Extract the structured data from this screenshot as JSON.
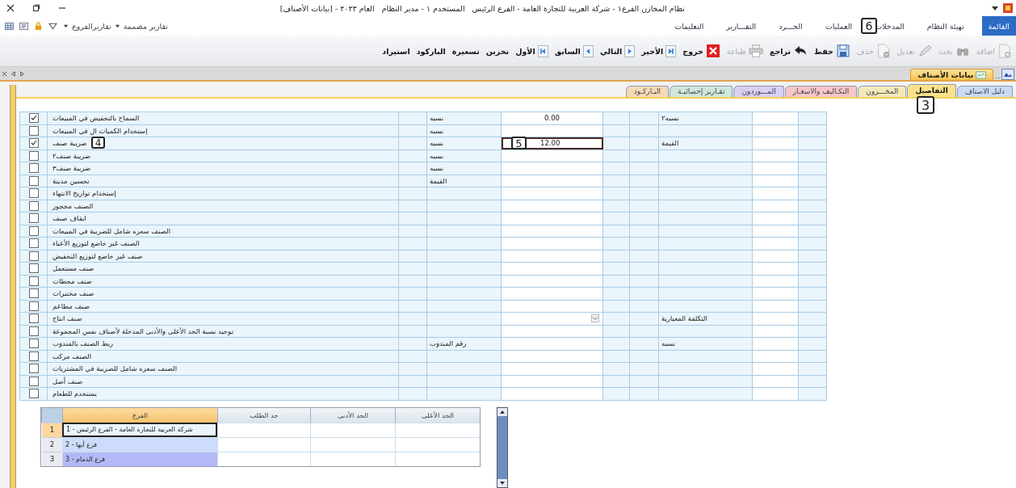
{
  "title_bar": {
    "title": "نظام المخازن الفرع١ - شركة العربية للتجارة العامة - الفرع الرئيس   المستخدم ١ - مدير النظام   العام ٢٠٢٣ - [بيانات الأصناف]"
  },
  "menu": [
    {
      "label": "القائمة",
      "selected": true
    },
    {
      "label": "تهيئة النظام",
      "selected": false
    },
    {
      "label": "المدخلات",
      "selected": false
    },
    {
      "label": "العمليات",
      "selected": false
    },
    {
      "label": "الجـــرد",
      "selected": false
    },
    {
      "label": "التقـــارير",
      "selected": false
    },
    {
      "label": "التعليمات",
      "selected": false
    }
  ],
  "report_menus": [
    {
      "label": "تقارير مصممة"
    },
    {
      "label": "تقاريرالفروع"
    }
  ],
  "toolbar": [
    {
      "label": "اضافة",
      "kind": "add",
      "disabled": true
    },
    {
      "label": "بحث",
      "kind": "search",
      "disabled": true
    },
    {
      "label": "تعديل",
      "kind": "edit",
      "disabled": true
    },
    {
      "label": "حذف",
      "kind": "delete",
      "disabled": true
    },
    {
      "label": "حفظ",
      "kind": "save",
      "disabled": false
    },
    {
      "label": "تراجع",
      "kind": "undo",
      "disabled": false
    },
    {
      "label": "طباعة",
      "kind": "print",
      "disabled": true
    },
    {
      "label": "خروج",
      "kind": "exit",
      "disabled": false
    },
    {
      "label": "الأخير",
      "kind": "last",
      "disabled": false
    },
    {
      "label": "التالي",
      "kind": "next",
      "disabled": false
    },
    {
      "label": "السابق",
      "kind": "prev",
      "disabled": false
    },
    {
      "label": "الأول",
      "kind": "first",
      "disabled": false
    },
    {
      "label": "تخزين",
      "kind": "text",
      "disabled": false
    },
    {
      "label": "تسعيرة",
      "kind": "text",
      "disabled": false
    },
    {
      "label": "الباركود",
      "kind": "text",
      "disabled": false
    },
    {
      "label": "استيراد",
      "kind": "text",
      "disabled": false
    }
  ],
  "document_tab": {
    "label": "بيانات الأصناف",
    "more": ".."
  },
  "tabs": [
    {
      "label": "دليل الاصناف",
      "selected": false,
      "color": "#c9dcf5"
    },
    {
      "label": "التفاصيل",
      "selected": true,
      "color": "#fbe28a"
    },
    {
      "label": "المخـــزون",
      "selected": false,
      "color": "#f3e9b8"
    },
    {
      "label": "التكـاليف والاسعـار",
      "selected": false,
      "color": "#f7c6c6"
    },
    {
      "label": "المـــوردون",
      "selected": false,
      "color": "#d9cff2"
    },
    {
      "label": "تقـارير إحصائيـة",
      "selected": false,
      "color": "#cfe8d9"
    },
    {
      "label": "البـاركـود",
      "selected": false,
      "color": "#f8d9b6"
    }
  ],
  "rows": [
    {
      "checked": true,
      "label": "السماح بالتخفيض في المبيعات",
      "column_4": "نسبه",
      "value": "0.00",
      "column_8": "نسبه٢",
      "kind": "text",
      "editing": false
    },
    {
      "checked": false,
      "label": "إستخدام الكميات ال في المبيعات",
      "column_4": "نسبه",
      "kind": "text",
      "editing": false
    },
    {
      "checked": true,
      "label": "ضريبة صنف",
      "column_4": "نسبه",
      "value": "12.00",
      "column_8": "القيمة",
      "kind": "text",
      "editing": true
    },
    {
      "checked": false,
      "label": "ضريبة صنف٢",
      "column_4": "نسبه",
      "kind": "text",
      "editing": false
    },
    {
      "checked": false,
      "label": "ضريبة صنف٣",
      "column_4": "نسبه",
      "kind": "text",
      "editing": false
    },
    {
      "checked": false,
      "label": "تحسين مدينة",
      "column_4": "القيمة",
      "kind": "text",
      "editing": false
    },
    {
      "checked": false,
      "label": "إستخدام تواريخ الانتهاء",
      "kind": "text",
      "editing": false
    },
    {
      "checked": false,
      "label": "الصنف محجوز",
      "kind": "text",
      "editing": false
    },
    {
      "checked": false,
      "label": "ايقاف صنف",
      "kind": "text",
      "editing": false
    },
    {
      "checked": false,
      "label": "الصنف سعره شامل للضريبة في المبيعات",
      "kind": "text",
      "editing": false
    },
    {
      "checked": false,
      "label": "الصنف غير خاضع لتوزيع الأعباء",
      "kind": "text",
      "editing": false
    },
    {
      "checked": false,
      "label": "صنف غير خاضع لتوزيع التخفيض",
      "kind": "text",
      "editing": false
    },
    {
      "checked": false,
      "label": "صنف مستعمل",
      "kind": "text",
      "editing": false
    },
    {
      "checked": false,
      "label": "صنف محطات",
      "kind": "text",
      "editing": false
    },
    {
      "checked": false,
      "label": "صنف مختبرات",
      "kind": "text",
      "editing": false
    },
    {
      "checked": false,
      "label": "صنف مطاعم",
      "kind": "text",
      "editing": false
    },
    {
      "checked": false,
      "label": "صنف انتاج",
      "column_8": "التكلفة المعيارية",
      "kind": "combo",
      "editing": false
    },
    {
      "checked": false,
      "label": "توحيد نسبة الحد الأعلى والأدنى المدخلة لأصناف نفس المجموعة",
      "kind": "text",
      "editing": false
    },
    {
      "checked": false,
      "label": "ربط الصنف بالمندوب",
      "column_4": "رقم المندوب",
      "column_8": "نسبه",
      "kind": "text",
      "editing": false
    },
    {
      "checked": false,
      "label": "الصنف مركب",
      "kind": "text",
      "editing": false
    },
    {
      "checked": false,
      "label": "الصنف سعره شامل للضريبة في المشتريات",
      "kind": "text",
      "editing": false
    },
    {
      "checked": false,
      "label": "صنف أصل",
      "kind": "text",
      "editing": false
    },
    {
      "checked": false,
      "label": "يستخدم للطعام",
      "kind": "text",
      "editing": false
    }
  ],
  "branch_table": {
    "columns": [
      "الحد الأعلى",
      "الحد الأدنى",
      "حد الطلب",
      "الفرع"
    ],
    "rows": [
      {
        "number": "1",
        "branch": "شركة العربية للتجارة العامة - الفرع الرئيس - 1",
        "selected": true,
        "color": "#eaf4fc"
      },
      {
        "number": "2",
        "branch": "فرع أبها - 2",
        "selected": false,
        "color": "#cddcfa"
      },
      {
        "number": "3",
        "branch": "فرع الدمام - 3",
        "selected": false,
        "color": "#b3b9f7"
      }
    ]
  },
  "callouts": [
    {
      "label": "6"
    },
    {
      "label": "3"
    },
    {
      "label": "4"
    },
    {
      "label": "5"
    }
  ]
}
